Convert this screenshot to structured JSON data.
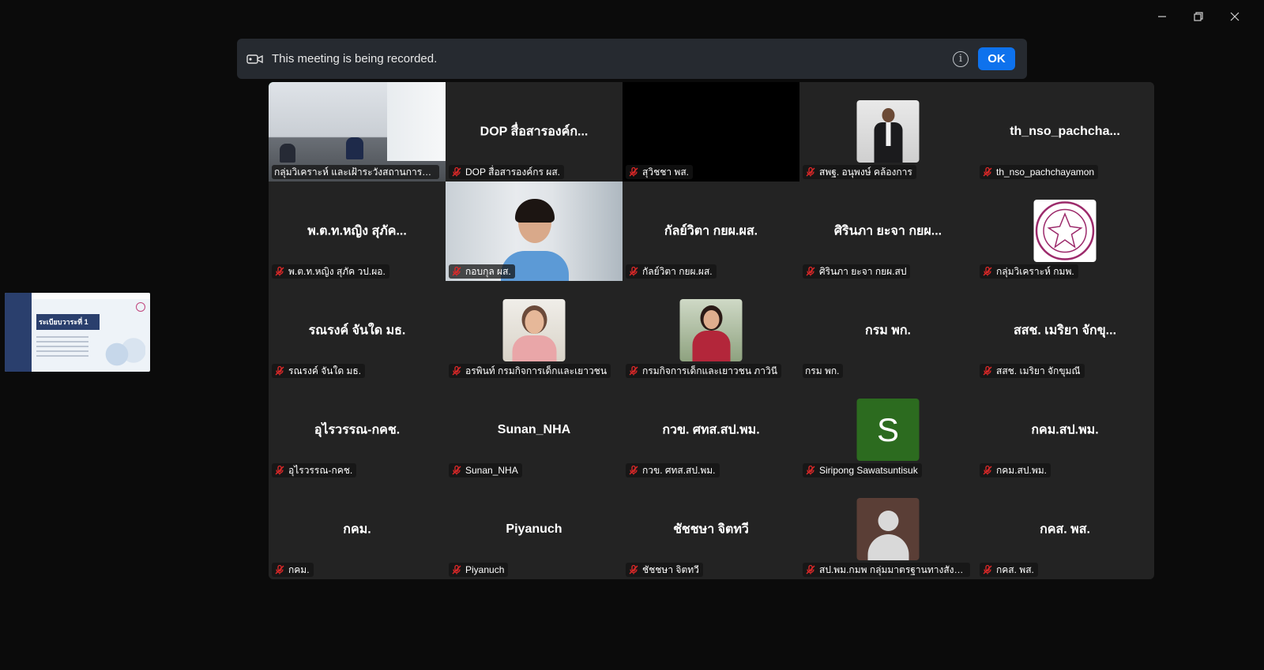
{
  "window": {
    "minimize_icon": "minimize-icon",
    "restore_icon": "restore-icon",
    "close_icon": "close-icon"
  },
  "banner": {
    "message": "This meeting is being recorded.",
    "ok_label": "OK",
    "info_glyph": "i"
  },
  "thumbnail": {
    "title": "ระเบียบวาระที่ 1"
  },
  "tiles": [
    {
      "label": "กลุ่มวิเคราะห์ และเฝ้าระวังสถานการณ์ทางสั..."
    },
    {
      "center": "DOP สื่อสารองค์ก...",
      "label": "DOP สื่อสารองค์กร ผส."
    },
    {
      "label": "สุวิชชา พส."
    },
    {
      "label": "สพฐ. อนุพงษ์ คล้องการ"
    },
    {
      "center": "th_nso_pachcha...",
      "label": "th_nso_pachchayamon"
    },
    {
      "center": "พ.ต.ท.หญิง สุภัค...",
      "label": "พ.ต.ท.หญิง สุภัค วป.ผอ."
    },
    {
      "label": "กอบกุล ผส."
    },
    {
      "center": "กัลย์วิตา กยผ.ผส.",
      "label": "กัลย์วิตา กยผ.ผส."
    },
    {
      "center": "ศิรินภา ยะจา กยผ...",
      "label": "ศิรินภา ยะจา กยผ.สป"
    },
    {
      "label": "กลุ่มวิเคราะห์ กมพ."
    },
    {
      "center": "รณรงค์ จันใด มธ.",
      "label": "รณรงค์ จันใด มธ."
    },
    {
      "label": "อรพินท์ กรมกิจการเด็กและเยาวชน"
    },
    {
      "label": "กรมกิจการเด็กและเยาวชน ภาวินี"
    },
    {
      "center": "กรม พก.",
      "label": "กรม พก."
    },
    {
      "center": "สสช. เมริยา จักขุ...",
      "label": "สสช. เมริยา จักขุมณี"
    },
    {
      "center": "อุไรวรรณ-กคช.",
      "label": "อุไรวรรณ-กคช."
    },
    {
      "center": "Sunan_NHA",
      "label": "Sunan_NHA"
    },
    {
      "center": "กวข. ศทส.สป.พม.",
      "label": "กวข. ศทส.สป.พม."
    },
    {
      "avatar_letter": "S",
      "label": "Siripong Sawatsuntisuk"
    },
    {
      "center": "กคม.สป.พม.",
      "label": "กคม.สป.พม."
    },
    {
      "center": "กคม.",
      "label": "กคม."
    },
    {
      "center": "Piyanuch",
      "label": "Piyanuch"
    },
    {
      "center": "ชัชชษา จิตทวี",
      "label": "ชัชชษา จิตทวี"
    },
    {
      "label": "สป.พม.กมพ กลุ่มมาตรฐานทางสังคม"
    },
    {
      "center": "กคส. พส.",
      "label": "กคส. พส."
    }
  ],
  "colors": {
    "accent": "#0e72ed",
    "active_speaker": "#26c281",
    "mute_red": "#e02828",
    "grid_bg": "#232323"
  }
}
